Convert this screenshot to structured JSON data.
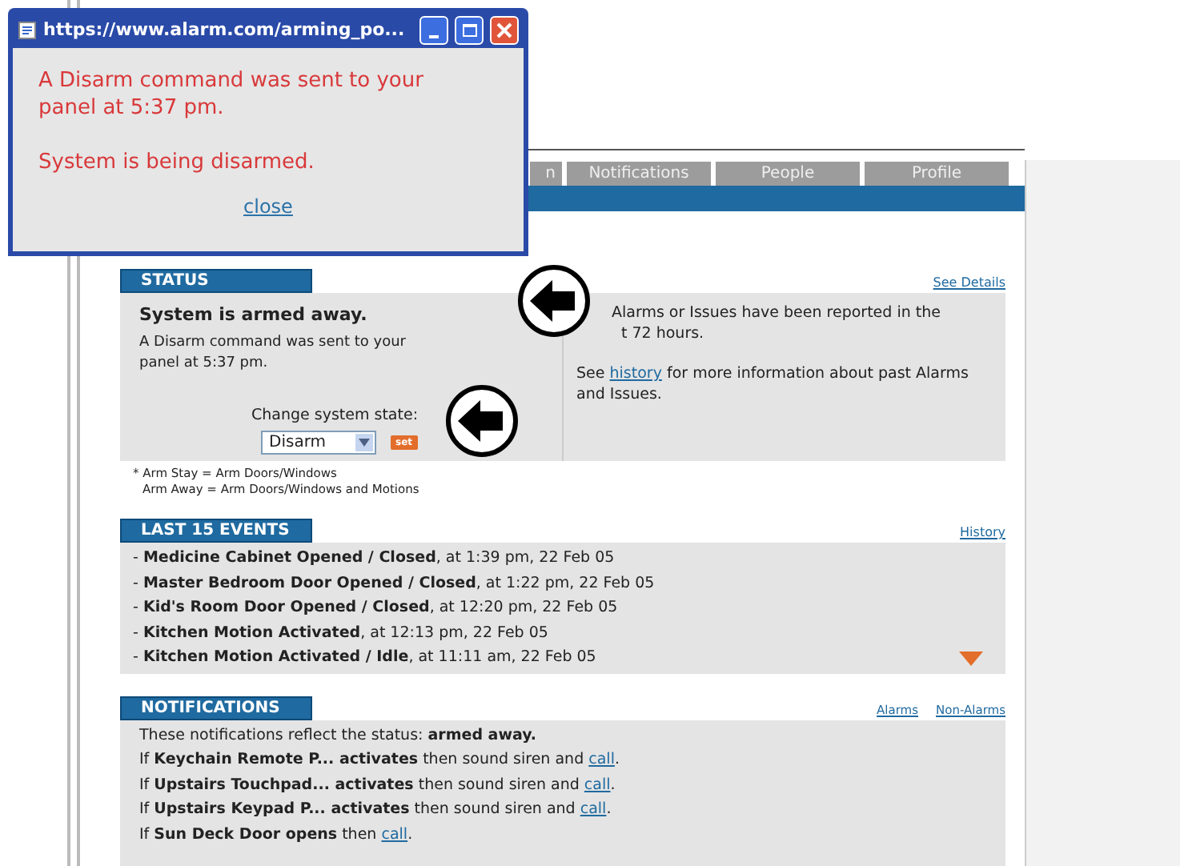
{
  "popup": {
    "title": "https://www.alarm.com/arming_po...",
    "message": "A Disarm command was sent to your panel at 5:37 pm.",
    "status": "System is being disarmed.",
    "close": "close"
  },
  "tabs": [
    {
      "label": "n"
    },
    {
      "label": "Notifications"
    },
    {
      "label": "People"
    },
    {
      "label": "Profile"
    }
  ],
  "status": {
    "header": "STATUS",
    "link": "See Details",
    "title": "System is armed away.",
    "message": "A Disarm command was sent to your panel at 5:37 pm.",
    "change_label": "Change system state:",
    "select_value": "Disarm",
    "set_button": "set",
    "alarms_lines": [
      "Alarms or Issues have been reported in the",
      "t 72 hours."
    ],
    "history_before": "See",
    "history_link": "history",
    "history_after": "for more information about past Alarms and Issues.",
    "footnotes": [
      "* Arm Stay = Arm Doors/Windows",
      "Arm Away = Arm Doors/Windows and Motions"
    ]
  },
  "events": {
    "header": "LAST 15 EVENTS",
    "link": "History",
    "items": [
      "- **Medicine Cabinet Opened / Closed**, at 1:39 pm, 22 Feb 05",
      "- **Master Bedroom Door Opened / Closed**, at 1:22 pm, 22 Feb 05",
      "- **Kid's Room Door Opened / Closed**, at 12:20 pm, 22 Feb 05",
      "- **Kitchen Motion Activated**, at 12:13 pm, 22 Feb 05",
      "- **Kitchen Motion Activated / Idle**, at 11:11 am, 22 Feb 05"
    ]
  },
  "notifications": {
    "header": "NOTIFICATIONS",
    "links": [
      "Alarms",
      "Non-Alarms"
    ],
    "intro": "These notifications reflect the status:  **armed away.**",
    "rules": [
      {
        "text": "If **Keychain Remote P... activates** then sound siren and",
        "link": "call",
        "end": "."
      },
      {
        "text": "If **Upstairs Touchpad... activates** then sound siren and",
        "link": "call",
        "end": "."
      },
      {
        "text": "If **Upstairs Keypad P... activates** then sound siren and",
        "link": "call",
        "end": "."
      },
      {
        "text": "If **Sun Deck Door opens** then",
        "link": "call",
        "end": "."
      }
    ]
  }
}
